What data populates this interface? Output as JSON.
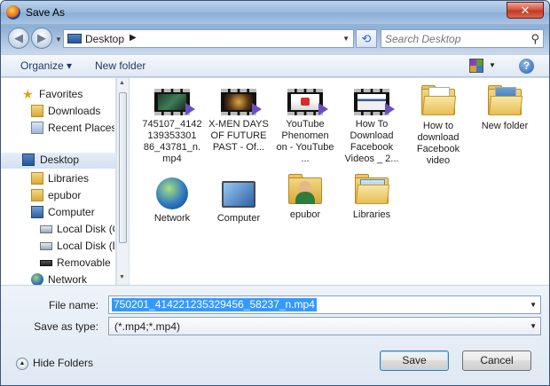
{
  "window": {
    "title": "Save As",
    "close_label": "✕"
  },
  "nav": {
    "address": "Desktop",
    "separator": "▶",
    "search_placeholder": "Search Desktop"
  },
  "toolbar": {
    "organize": "Organize ▾",
    "new_folder": "New folder"
  },
  "sidebar": {
    "items": [
      {
        "label": "Favorites",
        "icon": "star-icon"
      },
      {
        "label": "Downloads",
        "icon": "downloads-folder-icon"
      },
      {
        "label": "Recent Places",
        "icon": "recent-places-icon"
      },
      {
        "label": "Desktop",
        "icon": "desktop-icon"
      },
      {
        "label": "Libraries",
        "icon": "libraries-icon"
      },
      {
        "label": "epubor",
        "icon": "user-folder-icon"
      },
      {
        "label": "Computer",
        "icon": "computer-icon"
      },
      {
        "label": "Local Disk (C:)",
        "icon": "drive-icon"
      },
      {
        "label": "Local Disk (D:)",
        "icon": "drive-icon"
      },
      {
        "label": "Removable Di",
        "icon": "removable-drive-icon"
      },
      {
        "label": "Network",
        "icon": "network-icon"
      }
    ]
  },
  "files": [
    {
      "name": "745107_4142139353301 86_43781_n.mp4",
      "kind": "video"
    },
    {
      "name": "X-MEN DAYS OF FUTURE PAST - Of...",
      "kind": "video"
    },
    {
      "name": "YouTube Phenomen on - YouTube ...",
      "kind": "video"
    },
    {
      "name": "How To Download Facebook Videos _ 2...",
      "kind": "video"
    },
    {
      "name": "How to download Facebook video",
      "kind": "folder"
    },
    {
      "name": "New folder",
      "kind": "folder"
    },
    {
      "name": "Network",
      "kind": "network"
    },
    {
      "name": "Computer",
      "kind": "computer"
    },
    {
      "name": "epubor",
      "kind": "user"
    },
    {
      "name": "Libraries",
      "kind": "libraries"
    }
  ],
  "form": {
    "file_name_label": "File name:",
    "file_name_value": "750201_414221235329456_58237_n.mp4",
    "save_type_label": "Save as type:",
    "save_type_value": "(*.mp4;*.mp4)"
  },
  "footer": {
    "hide_folders": "Hide Folders",
    "save": "Save",
    "cancel": "Cancel"
  }
}
